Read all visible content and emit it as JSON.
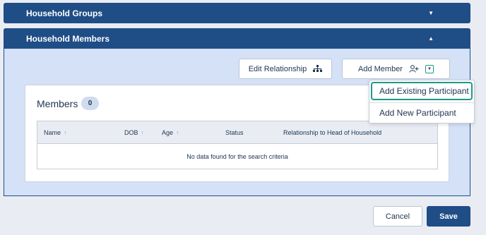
{
  "sections": {
    "groups_title": "Household Groups",
    "groups_caret": "▼",
    "members_title": "Household Members",
    "members_caret": "▲"
  },
  "toolbar": {
    "edit_relationship_label": "Edit Relationship",
    "edit_relationship_icon": "hierarchy-icon",
    "add_member_label": "Add Member",
    "add_member_icon": "add-person-icon",
    "dropdown_caret": "▼"
  },
  "members": {
    "title": "Members",
    "count": "0",
    "columns": [
      {
        "label": "Name",
        "sort": "↑"
      },
      {
        "label": "DOB",
        "sort": "↑"
      },
      {
        "label": "Age",
        "sort": "↑"
      },
      {
        "label": "Status",
        "sort": ""
      },
      {
        "label": "Relationship to Head of Household",
        "sort": ""
      }
    ],
    "empty_message": "No data found for the search criteria"
  },
  "add_menu": {
    "items": [
      {
        "label": "Add Existing Participant",
        "highlighted": true
      },
      {
        "label": "Add New Participant",
        "highlighted": false
      }
    ],
    "highlight_color": "#1b9a8a"
  },
  "footer": {
    "cancel_label": "Cancel",
    "save_label": "Save"
  },
  "colors": {
    "header_bg": "#1f4d86",
    "body_bg": "#d4e1f6",
    "page_bg": "#e9edf3"
  }
}
